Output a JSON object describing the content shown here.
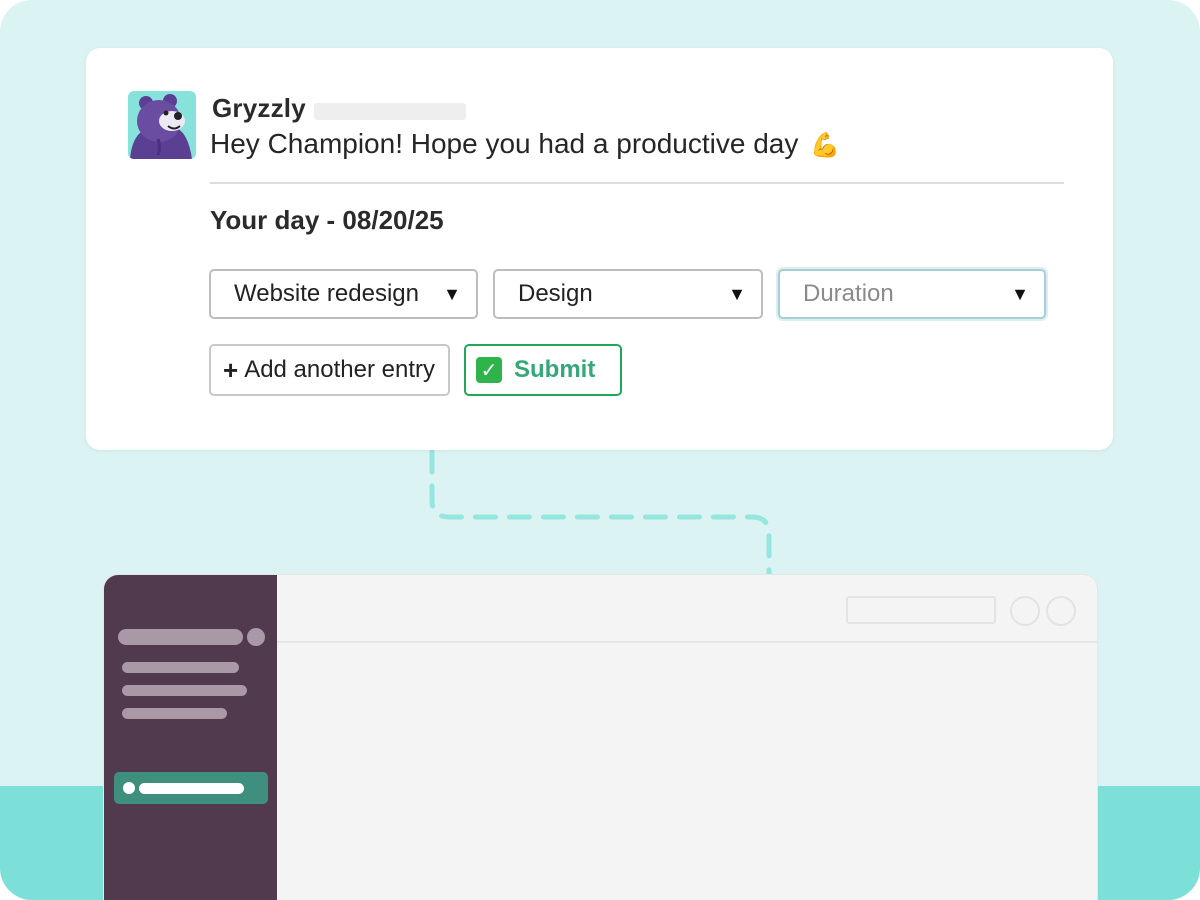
{
  "message": {
    "sender": "Gryzzly",
    "text": "Hey Champion! Hope you had a productive day",
    "emoji": "💪",
    "day_title": "Your day - 08/20/25"
  },
  "form": {
    "project_select": "Website redesign",
    "task_select": "Design",
    "duration_placeholder": "Duration",
    "add_entry_label": "Add another entry",
    "submit_label": "Submit"
  },
  "icons": {
    "avatar": "bear-mascot-icon",
    "caret": "caret-down-icon",
    "plus": "plus-icon",
    "check": "check-box-icon"
  },
  "colors": {
    "background": "#dbf3f2",
    "floor": "#7cdfd8",
    "sidebar": "#513a4e",
    "active_item": "#3e8f7e",
    "submit_border": "#1fa85a",
    "submit_text": "#35a87a",
    "avatar_bg": "#86e2db",
    "bear": "#6a4ca0"
  }
}
